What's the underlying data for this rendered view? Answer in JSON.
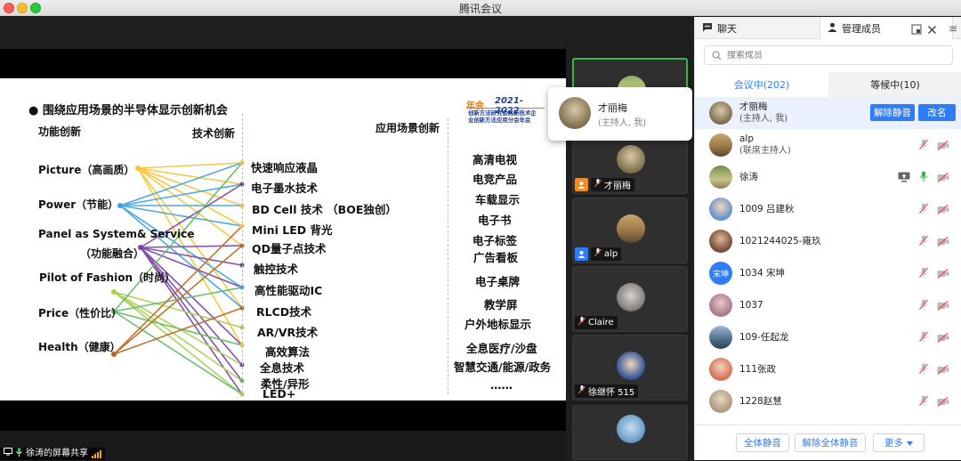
{
  "window": {
    "title": "腾讯会议"
  },
  "share": {
    "label": "徐涛的屏幕共享"
  },
  "slide": {
    "title": "围绕应用场景的半导体显示创新机会",
    "col1_header": "功能创新",
    "col2_header": "技术创新",
    "col3_header": "应用场景创新",
    "functions": [
      "Picture（高画质）",
      "Power（节能）",
      "Panel as System& Service",
      "（功能融合）",
      "Pilot of Fashion（时尚）",
      "Price（性价比）",
      "Health（健康）"
    ],
    "technologies": [
      "快速响应液晶",
      "电子墨水技术",
      "BD Cell 技术 （BOE独创）",
      "Mini LED 背光",
      "QD量子点技术",
      "触控技术",
      "高性能驱动IC",
      "RLCD技术",
      "AR/VR技术",
      "高效算法",
      "全息技术",
      "柔性/异形",
      "LED+"
    ],
    "applications": [
      "高清电视",
      "电竞产品",
      "车载显示",
      "电子书",
      "电子标签",
      "广告看板",
      "电子桌牌",
      "教学屏",
      "户外地标显示",
      "全息医疗/沙盘",
      "智慧交通/能源/政务",
      "……"
    ],
    "conference": {
      "badge": "年会",
      "years": "2021-2022",
      "line1": "创新方法研究会高新技术企",
      "line2": "业创新方法应用分会年会"
    }
  },
  "videos": [
    {
      "name": ""
    },
    {
      "name": "才丽梅"
    },
    {
      "name": "alp"
    },
    {
      "name": "Claire"
    },
    {
      "name": "徐继怀 515"
    }
  ],
  "popup": {
    "name": "才丽梅",
    "role": "(主持人, 我)"
  },
  "panel": {
    "tab_chat": "聊天",
    "tab_members": "管理成员",
    "search_placeholder": "搜索成员",
    "tab_in_meeting": "会议中(202)",
    "tab_waiting": "等候中(10)",
    "members": [
      {
        "name": "才丽梅",
        "sub": "(主持人, 我)",
        "avatar_text": ""
      },
      {
        "name": "alp",
        "sub": "(联席主持人)",
        "avatar_text": ""
      },
      {
        "name": "徐涛",
        "sub": "",
        "avatar_text": ""
      },
      {
        "name": "1009 吕建秋",
        "sub": "",
        "avatar_text": ""
      },
      {
        "name": "1021244025-雍玖",
        "sub": "",
        "avatar_text": ""
      },
      {
        "name": "1034 宋坤",
        "sub": "",
        "avatar_text": "宋坤"
      },
      {
        "name": "1037",
        "sub": "",
        "avatar_text": ""
      },
      {
        "name": "109-任起龙",
        "sub": "",
        "avatar_text": ""
      },
      {
        "name": "111张政",
        "sub": "",
        "avatar_text": ""
      },
      {
        "name": "1228赵慧",
        "sub": "",
        "avatar_text": ""
      }
    ],
    "btn_unmute": "解除静音",
    "btn_rename": "改名",
    "footer": {
      "mute_all": "全体静音",
      "unmute_all": "解除全体静音",
      "more": "更多"
    }
  },
  "colors": {
    "accent": "#2f7df6",
    "mic_on": "#3ab54a",
    "muted_red": "#e05656",
    "host_orange": "#f18b28"
  }
}
